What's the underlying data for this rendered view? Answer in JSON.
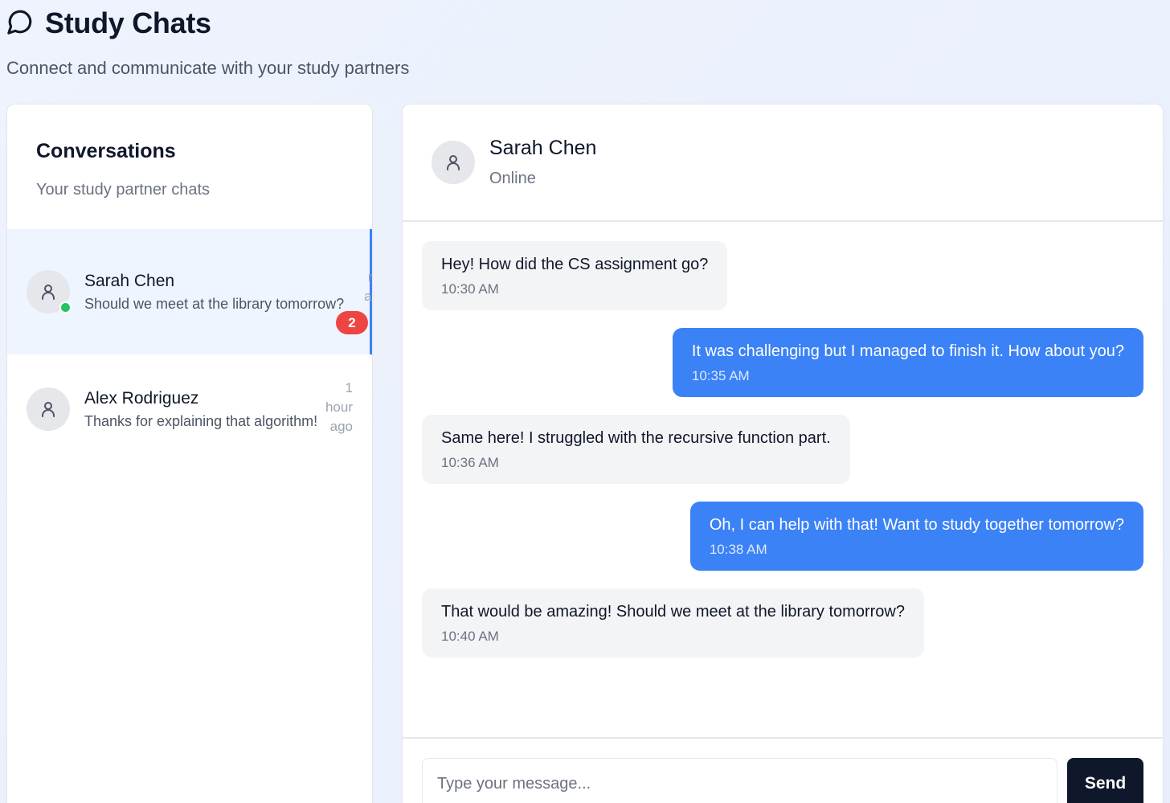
{
  "header": {
    "title": "Study Chats",
    "subtitle": "Connect and communicate with your study partners",
    "icon": "message-circle-icon"
  },
  "sidebar": {
    "title": "Conversations",
    "subtitle": "Your study partner chats",
    "conversations": [
      {
        "name": "Sarah Chen",
        "last_message": "Should we meet at the library tomorrow?",
        "time_line1": "m",
        "time_line2": "ag",
        "unread": "2",
        "online": true,
        "active": true
      },
      {
        "name": "Alex Rodriguez",
        "last_message": "Thanks for explaining that algorithm!",
        "time_line1": "1",
        "time_line2": "hour",
        "time_line3": "ago",
        "online": false,
        "active": false
      }
    ]
  },
  "chat": {
    "contact_name": "Sarah Chen",
    "contact_status": "Online",
    "messages": [
      {
        "direction": "in",
        "text": "Hey! How did the CS assignment go?",
        "time": "10:30 AM"
      },
      {
        "direction": "out",
        "text": "It was challenging but I managed to finish it. How about you?",
        "time": "10:35 AM"
      },
      {
        "direction": "in",
        "text": "Same here! I struggled with the recursive function part.",
        "time": "10:36 AM"
      },
      {
        "direction": "out",
        "text": "Oh, I can help with that! Want to study together tomorrow?",
        "time": "10:38 AM"
      },
      {
        "direction": "in",
        "text": "That would be amazing! Should we meet at the library tomorrow?",
        "time": "10:40 AM"
      }
    ],
    "composer": {
      "placeholder": "Type your message...",
      "value": "",
      "send_label": "Send"
    }
  },
  "colors": {
    "accent": "#3b82f6",
    "online": "#22c55e",
    "badge": "#ef4444",
    "send_button": "#0f172a"
  }
}
